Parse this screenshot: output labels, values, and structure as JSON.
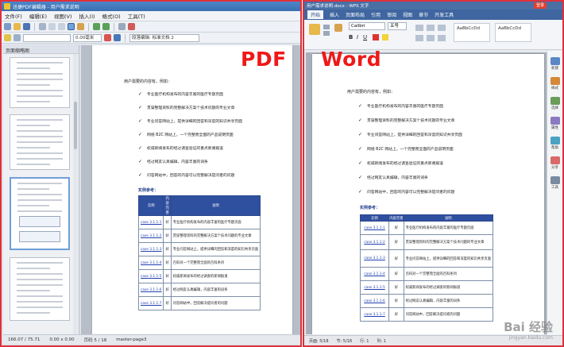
{
  "labels": {
    "pdf": "PDF",
    "word": "Word"
  },
  "pdf_app": {
    "title": "迅捷PDF编辑器 - 用户需求说明",
    "menu": [
      "文件(F)",
      "编辑(E)",
      "视图(V)",
      "插入(I)",
      "格式(O)",
      "工具(T)"
    ],
    "zoom_value": "0.00毫米",
    "style_select": "段落编辑: 标准文档 2",
    "sidebar_title": "页面缩略图",
    "status": {
      "coords": "166.07 / 75.71",
      "size": "0.00 x 0.00",
      "page": "页码 5 / 18",
      "page_name": "master-page3"
    }
  },
  "word_app": {
    "title": "用户需求说明.docx - WPS 文字",
    "login": "登录",
    "menu": [
      "开始",
      "插入",
      "页面布局",
      "引用",
      "审阅",
      "视图",
      "章节",
      "开发工具"
    ],
    "active_menu": "开始",
    "font_name": "Calibri",
    "font_size": "五号",
    "style_label": "AaBbCcDd",
    "right_panel": [
      "新建",
      "样式",
      "选择",
      "属性",
      "帮助",
      "分享",
      "工具"
    ],
    "status": {
      "page": "页面: 5/18",
      "section": "节: 5/18",
      "row": "行: 1",
      "col": "列: 1"
    }
  },
  "doc": {
    "intro": "用户需要的内容有，例如：",
    "bullets": [
      "专业医疗机构发布的内容丰富的医疗专题页面",
      "贯穿整理资料的完整解决方案个技术问题的专业文章",
      "专业问答网站上，提供详细的回答和深度的知识共享页面",
      "网络 B2C 网站上，一个完整而全面的产品说明页面",
      "权威新闻发布的经过调查验证的重点新闻报道",
      "经过网友认真编辑，内容丰富的词条",
      "问答网站中，回答的内容可以完整解决提问者的问题"
    ],
    "examples_title": "实例参考：",
    "table_headers": [
      "实例",
      "内容完善",
      "说明"
    ],
    "table_rows": [
      [
        "case 3.1.1-1",
        "好",
        "专业医疗机构发布的内容丰富的医疗专题页面"
      ],
      [
        "case 3.1.1-2",
        "好",
        "贯穿整理资料的完整解决方案个技术问题的专业文章"
      ],
      [
        "case 3.1.1-3",
        "好",
        "专业问答网站上，提供详细的回答和深度的知识共享页面"
      ],
      [
        "case 3.1.1-4",
        "好",
        "百科对一个完整而全面的百科条目"
      ],
      [
        "case 3.1.1-5",
        "好",
        "权威新闻发布的经过调查的新闻报道"
      ],
      [
        "case 3.1.1-6",
        "好",
        "经过网友认真编辑，内容丰富的词条"
      ],
      [
        "case 3.1.1-7",
        "好",
        "问答网站中，回答解决提问者的问题"
      ]
    ]
  },
  "watermark": {
    "text": "Bai 经验",
    "sub": "jingyan.baidu.com"
  },
  "colors": {
    "frame": "#e0303a",
    "label": "#f01818",
    "table_header": "#2f4f9f",
    "link": "#1f3fb0"
  }
}
